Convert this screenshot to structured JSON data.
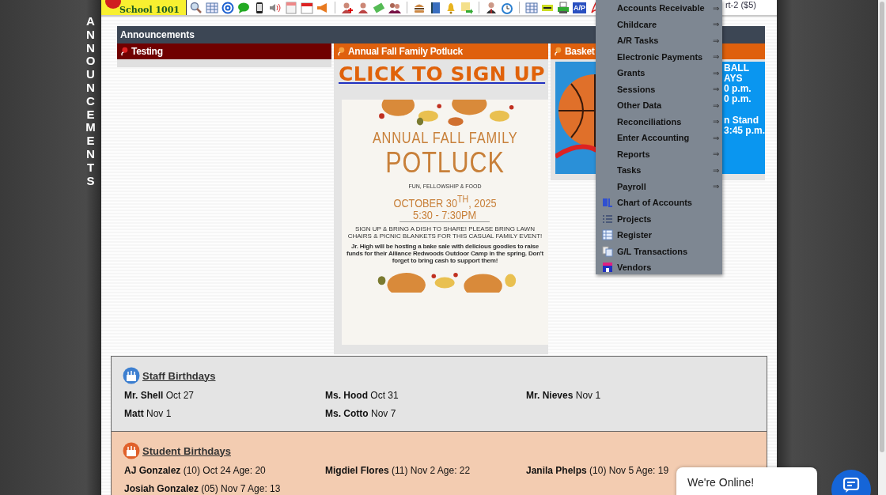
{
  "toolbar": {
    "logo_text": "School 1001",
    "icon_label": "A/P",
    "account_text": "rt-2 ($5)"
  },
  "sidebar": {
    "title": "ANNOUNCEMENTS"
  },
  "announcements": {
    "title": "Announcements",
    "columns": [
      {
        "kind": "empty",
        "title": "Testing",
        "color": "#700000"
      },
      {
        "kind": "potluck",
        "title": "Annual Fall Family Potluck",
        "color": "#df600d",
        "link": "CLICK TO SIGN UP",
        "poster": {
          "heading": "ANNUAL FALL FAMILY",
          "title": "POTLUCK",
          "tagline": "FUN, FELLOWSHIP & FOOD",
          "date": "OCTOBER 30$^{TH}$, 2025",
          "time": "5:30 - 7:30PM",
          "invite": "SIGN UP & BRING A DISH TO SHARE! PLEASE BRING LAWN CHAIRS & PICNIC BLANKETS FOR THIS CASUAL FAMILY EVENT!",
          "note": "Jr. High will be hosting a bake sale with delicious goodies to raise funds for their Alliance Redwoods Outdoor Camp in the spring. Don't forget to bring cash to support them!"
        }
      },
      {
        "kind": "basketball",
        "title": "Basket",
        "color": "#df600d",
        "fragments": [
          "BALL",
          "AYS",
          "0 p.m.",
          "0 p.m.",
          "n Stand",
          "3:45 p.m."
        ]
      }
    ]
  },
  "menu": {
    "items": [
      {
        "label": "Accounts Receivable",
        "kind": "submenu",
        "arrow": "⇒"
      },
      {
        "label": "Childcare",
        "kind": "submenu",
        "arrow": "⇒"
      },
      {
        "label": "A/R Tasks",
        "kind": "submenu",
        "arrow": "⇒"
      },
      {
        "label": "Electronic Payments",
        "kind": "submenu",
        "arrow": "⇒"
      },
      {
        "label": "Grants",
        "kind": "submenu",
        "arrow": "⇒"
      },
      {
        "label": "Sessions",
        "kind": "submenu",
        "arrow": "⇒"
      },
      {
        "label": "Other Data",
        "kind": "submenu",
        "arrow": "⇒"
      },
      {
        "label": "Reconciliations",
        "kind": "submenu",
        "arrow": "⇒"
      },
      {
        "label": "Enter Accounting",
        "kind": "submenu",
        "arrow": "⇒"
      },
      {
        "label": "Reports",
        "kind": "submenu",
        "arrow": "⇒"
      },
      {
        "label": "Tasks",
        "kind": "submenu",
        "arrow": "⇒"
      },
      {
        "label": "Payroll",
        "kind": "submenu",
        "arrow": "⇒"
      },
      {
        "label": "Chart of Accounts",
        "kind": "icon"
      },
      {
        "label": "Projects",
        "kind": "icon"
      },
      {
        "label": "Register",
        "kind": "icon"
      },
      {
        "label": "G/L Transactions",
        "kind": "icon"
      },
      {
        "label": "Vendors",
        "kind": "icon"
      }
    ]
  },
  "birthdays": [
    {
      "kind": "staff",
      "title": "Staff Birthdays",
      "entries": [
        {
          "name": "Mr. Shell",
          "detail": "Oct 27"
        },
        {
          "name": "Ms. Hood",
          "detail": "Oct 31"
        },
        {
          "name": "Mr. Nieves",
          "detail": "Nov 1"
        },
        {
          "name": "Matt",
          "detail": "Nov 1"
        },
        {
          "name": "Ms. Cotto",
          "detail": "Nov 7"
        }
      ]
    },
    {
      "kind": "student",
      "title": "Student Birthdays",
      "entries": [
        {
          "name": "AJ Gonzalez",
          "detail": "(10) Oct 24 Age: 20"
        },
        {
          "name": "Migdiel Flores",
          "detail": "(11) Nov 2 Age: 22"
        },
        {
          "name": "Janila Phelps",
          "detail": "(10) Nov 5 Age: 19"
        },
        {
          "name": "Josiah Gonzalez",
          "detail": "(05) Nov 7 Age: 13"
        }
      ]
    }
  ],
  "chat": {
    "bubble": "We're Online!"
  }
}
